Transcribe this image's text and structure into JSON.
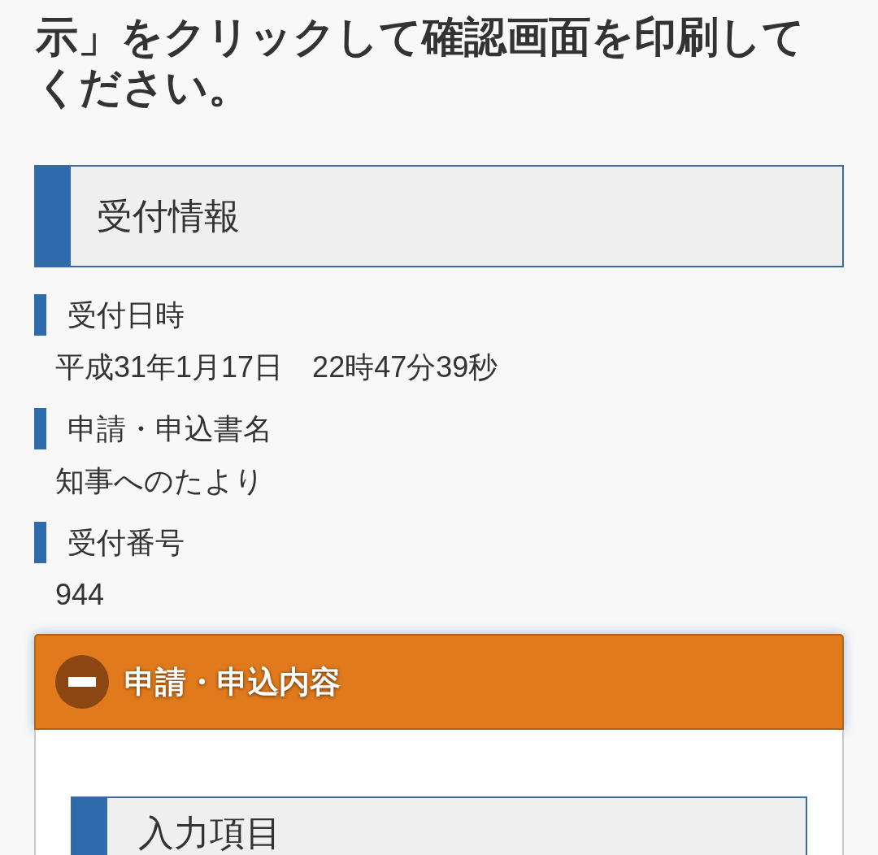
{
  "instruction": "示」をクリックして確認画面を印刷してください。",
  "reception_section": {
    "title": "受付情報",
    "fields": [
      {
        "label": "受付日時",
        "value": "平成31年1月17日　22時47分39秒"
      },
      {
        "label": "申請・申込書名",
        "value": "知事へのたより"
      },
      {
        "label": "受付番号",
        "value": "944"
      }
    ]
  },
  "accordion": {
    "title": "申請・申込内容",
    "expanded": true,
    "section": {
      "title": "入力項目"
    }
  }
}
